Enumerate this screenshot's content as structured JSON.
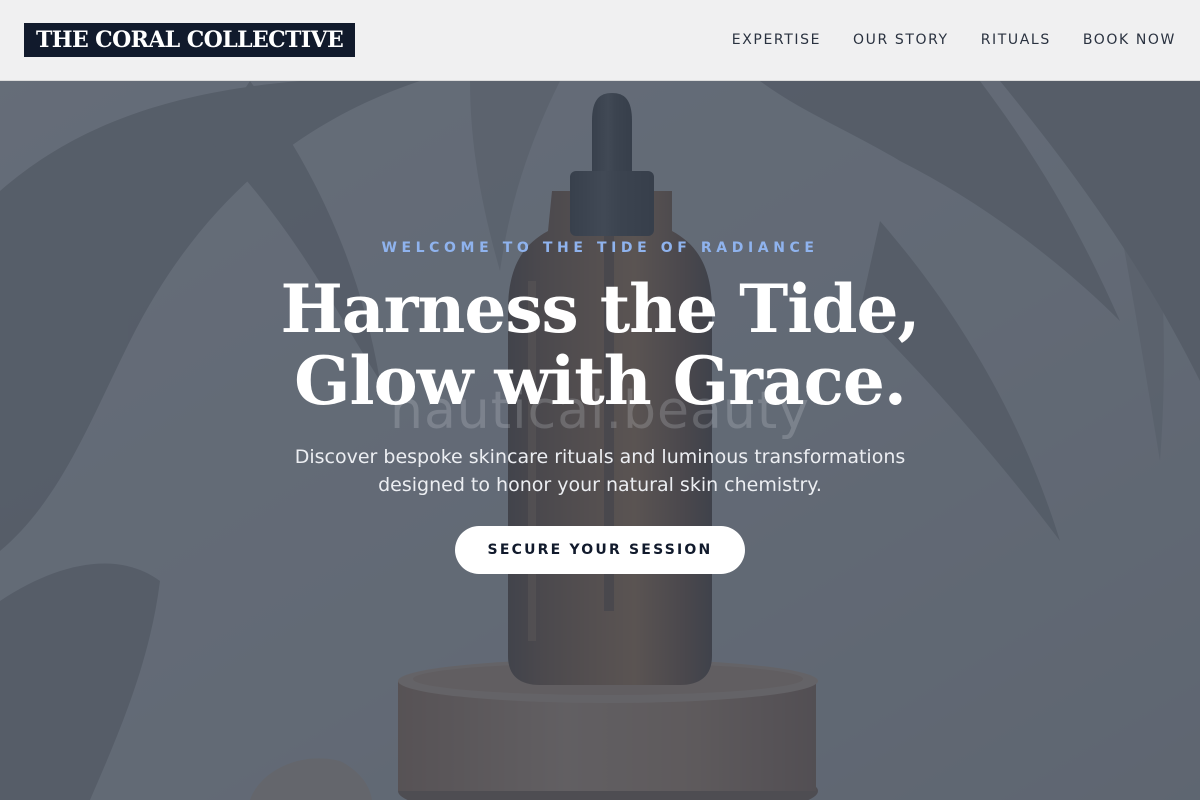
{
  "brand": {
    "name": "THE CORAL COLLECTIVE"
  },
  "nav": {
    "items": [
      {
        "label": "EXPERTISE"
      },
      {
        "label": "OUR STORY"
      },
      {
        "label": "RITUALS"
      },
      {
        "label": "BOOK NOW"
      }
    ]
  },
  "hero": {
    "eyebrow": "WELCOME TO THE TIDE OF RADIANCE",
    "watermark": "nautical.beauty",
    "headline_lines": [
      "Harness the Tide,",
      "Glow with Grace."
    ],
    "subtext_lines": [
      "Discover bespoke skincare rituals and luminous transformations",
      "designed to honor your natural skin chemistry."
    ],
    "cta_label": "SECURE YOUR SESSION",
    "image_subject": "amber-dropper-bottle-on-pedestal"
  },
  "colors": {
    "logo_bg": "#111a2c",
    "header_bg": "#f0f0f1",
    "eyebrow": "#8fb3ee",
    "overlay": "#4a5563",
    "cta_bg": "#ffffff",
    "cta_text": "#111a2c"
  }
}
